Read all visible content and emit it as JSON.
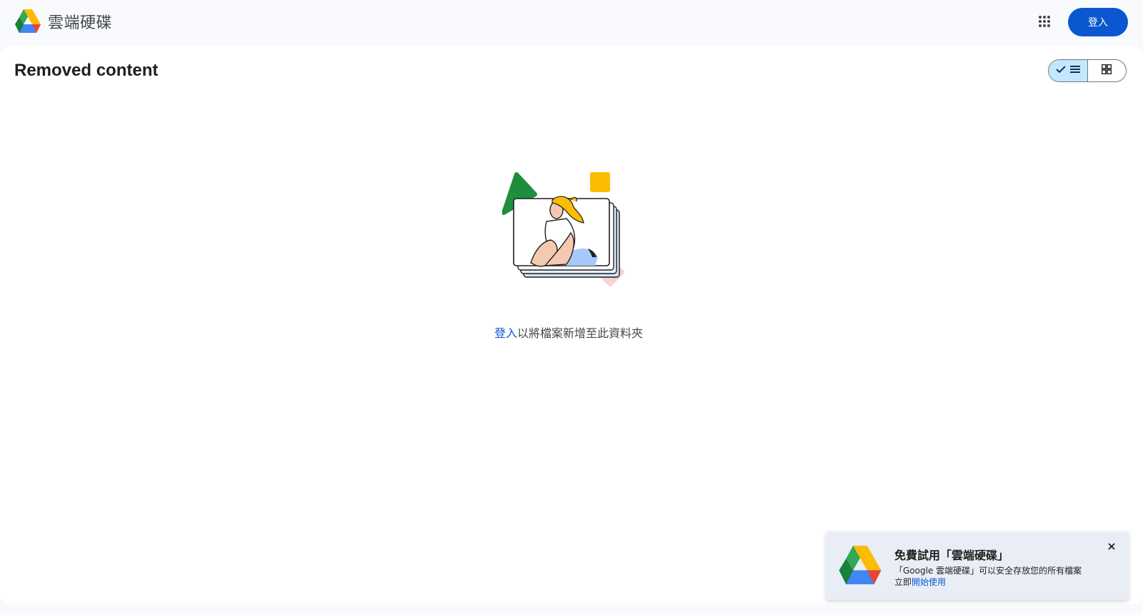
{
  "header": {
    "app_name": "雲端硬碟",
    "signin_label": "登入",
    "apps_icon": "apps-grid-icon"
  },
  "main": {
    "title": "Removed content",
    "view_toggle": {
      "selected": "list",
      "list_icon": "list-view-icon",
      "grid_icon": "grid-view-icon"
    },
    "empty_state": {
      "link_text": "登入",
      "message": "以將檔案新增至此資料夾"
    }
  },
  "promo": {
    "title": "免費試用「雲端硬碟」",
    "body_line1": "「Google 雲端硬碟」可以安全存放您的所有檔案",
    "body_prefix": "立即",
    "link_text": "開始使用"
  },
  "colors": {
    "primary": "#0b57d0",
    "selected_segment": "#c2e7ff",
    "background": "#f8fafd"
  }
}
